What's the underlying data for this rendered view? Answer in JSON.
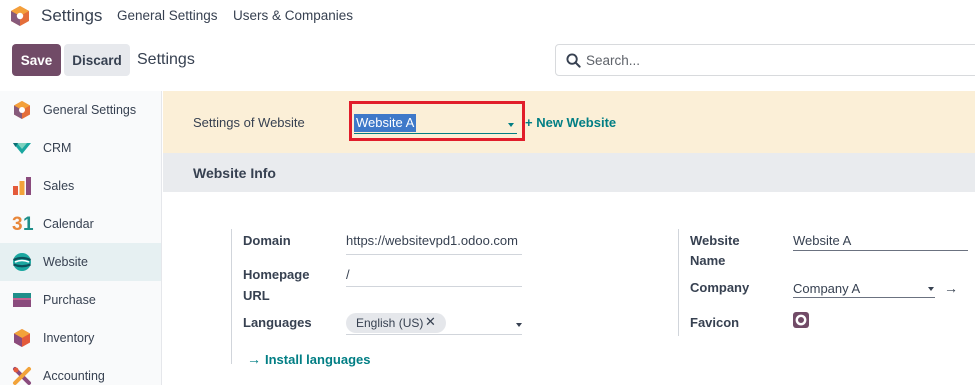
{
  "topnav": {
    "app_title": "Settings",
    "menu": [
      "General Settings",
      "Users & Companies"
    ]
  },
  "control_panel": {
    "save_label": "Save",
    "discard_label": "Discard",
    "breadcrumb": "Settings",
    "search_placeholder": "Search..."
  },
  "sidebar": {
    "items": [
      {
        "label": "General Settings",
        "icon": "odoo-logo-icon"
      },
      {
        "label": "CRM",
        "icon": "crm-icon"
      },
      {
        "label": "Sales",
        "icon": "sales-chart-icon"
      },
      {
        "label": "Calendar",
        "icon": "calendar-31-icon"
      },
      {
        "label": "Website",
        "icon": "website-icon",
        "active": true
      },
      {
        "label": "Purchase",
        "icon": "purchase-icon"
      },
      {
        "label": "Inventory",
        "icon": "inventory-icon"
      },
      {
        "label": "Accounting",
        "icon": "accounting-icon"
      }
    ]
  },
  "website_settings": {
    "label": "Settings of Website",
    "selected_website": "Website A",
    "new_website_label": "+ New Website"
  },
  "website_info": {
    "title": "Website Info",
    "domain_label": "Domain",
    "domain_value": "https://websitevpd1.odoo.com",
    "homepage_label_1": "Homepage",
    "homepage_label_2": "URL",
    "homepage_value": "/",
    "languages_label": "Languages",
    "language_tag": "English (US)",
    "install_languages_label": "Install languages",
    "website_name_label_1": "Website",
    "website_name_label_2": "Name",
    "website_name_value": "Website A",
    "company_label": "Company",
    "company_value": "Company A",
    "favicon_label": "Favicon"
  },
  "colors": {
    "brand": "#714b67",
    "accent": "#017e84",
    "band": "#fbefd7",
    "highlight": "#e11d2a"
  }
}
